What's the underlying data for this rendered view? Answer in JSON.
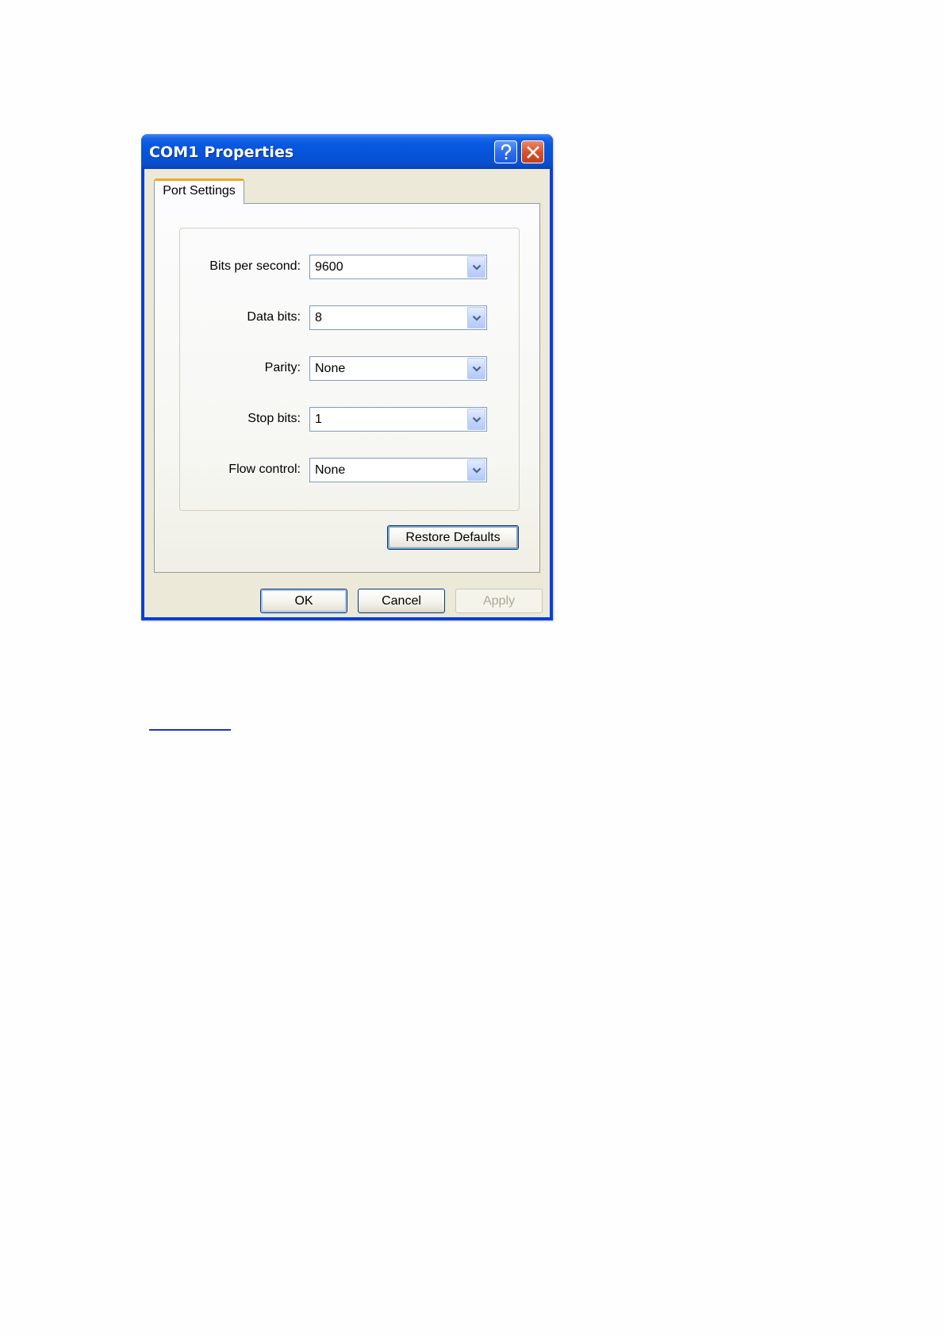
{
  "window": {
    "title": "COM1 Properties",
    "help_icon": "help-question-icon",
    "close_icon": "close-x-icon"
  },
  "tabs": [
    {
      "label": "Port Settings",
      "selected": true
    }
  ],
  "port_settings": {
    "bits_per_second": {
      "label": "Bits per second:",
      "value": "9600"
    },
    "data_bits": {
      "label": "Data bits:",
      "value": "8"
    },
    "parity": {
      "label": "Parity:",
      "value": "None"
    },
    "stop_bits": {
      "label": "Stop bits:",
      "value": "1"
    },
    "flow_control": {
      "label": "Flow control:",
      "value": "None"
    },
    "restore_defaults_label": "Restore Defaults"
  },
  "footer": {
    "ok_label": "OK",
    "cancel_label": "Cancel",
    "apply_label": "Apply",
    "apply_enabled": false
  },
  "colors": {
    "titlebar": "#0a56dc",
    "window_face": "#ece9d8",
    "tab_accent": "#f5a824",
    "link_underline": "#1f2fd0"
  }
}
